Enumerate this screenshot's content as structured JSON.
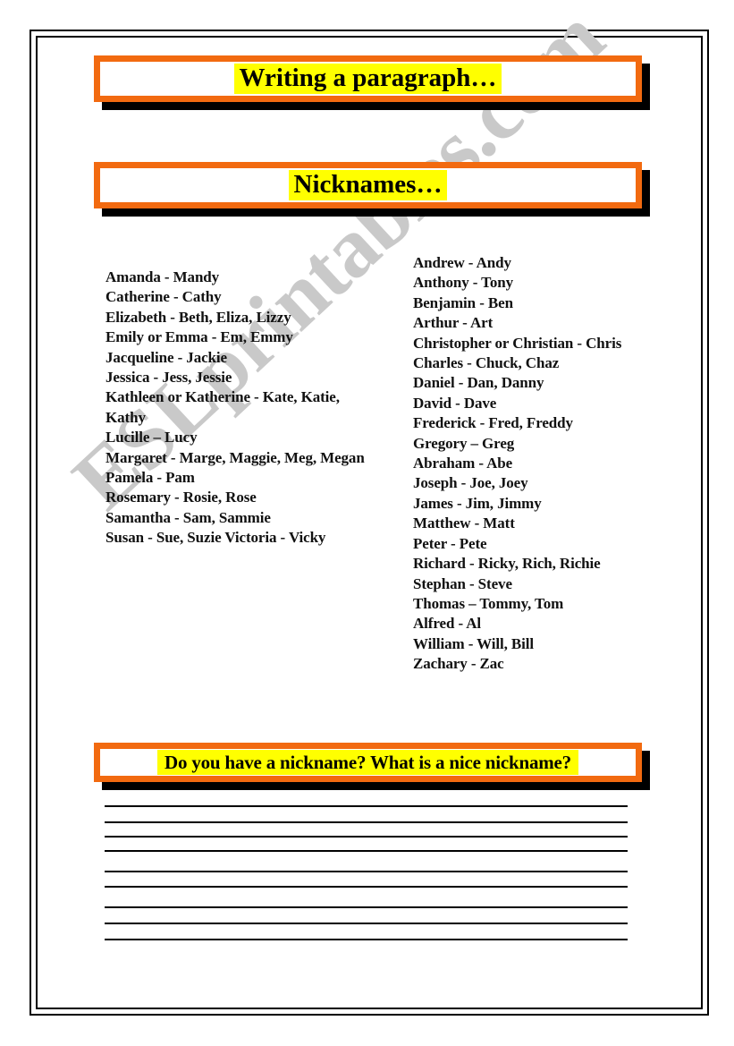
{
  "page": {
    "title_banner": "Writing a paragraph…",
    "subtitle_banner": "Nicknames…",
    "question_banner": "Do you have a nickname? What is a nice nickname?",
    "watermark": "ESLprintables.com"
  },
  "colors": {
    "accent_orange": "#f26a10",
    "highlight_yellow": "#ffff00",
    "shadow_black": "#000000",
    "watermark_gray": "#c9c9c9",
    "text_black": "#111111"
  },
  "nicknames": {
    "female_column": [
      "Amanda - Mandy",
      "Catherine - Cathy",
      "Elizabeth - Beth, Eliza, Lizzy",
      "Emily or Emma - Em, Emmy",
      "Jacqueline - Jackie",
      "Jessica - Jess, Jessie",
      "Kathleen or Katherine - Kate, Katie, Kathy",
      "Lucille – Lucy",
      "Margaret - Marge, Maggie, Meg, Megan",
      "Pamela - Pam",
      "Rosemary - Rosie, Rose",
      "Samantha - Sam, Sammie",
      "Susan - Sue, Suzie Victoria - Vicky"
    ],
    "male_column": [
      "Andrew - Andy",
      "Anthony - Tony",
      "Benjamin - Ben",
      "Arthur - Art",
      "Christopher or Christian - Chris",
      "Charles - Chuck, Chaz",
      "Daniel - Dan, Danny",
      "David - Dave",
      "Frederick - Fred, Freddy",
      "Gregory – Greg",
      "Abraham - Abe",
      "Joseph - Joe, Joey",
      "James - Jim, Jimmy",
      "Matthew - Matt",
      "Peter - Pete",
      "Richard - Ricky, Rich, Richie",
      "Stephan - Steve",
      "Thomas – Tommy, Tom",
      "Alfred - Al",
      "William - Will, Bill",
      "Zachary - Zac"
    ]
  },
  "answer_lines": {
    "count": 9,
    "offsets": [
      7,
      25,
      41,
      57,
      80,
      97,
      120,
      138,
      156
    ]
  }
}
